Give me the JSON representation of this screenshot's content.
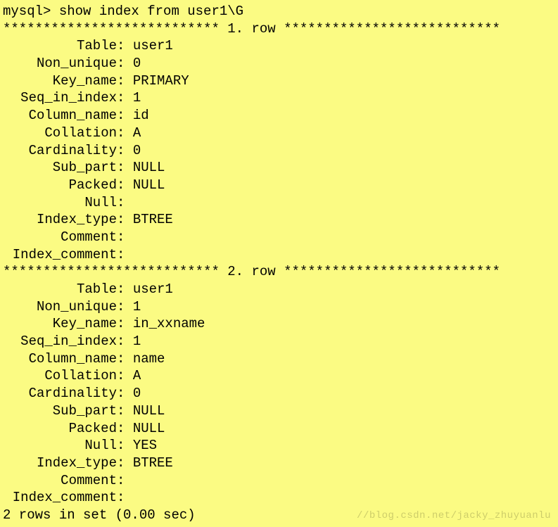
{
  "prompt": "mysql> show index from user1\\G",
  "row_separator_prefix": "*************************** ",
  "row_word": ". row ",
  "row_separator_suffix": "***************************",
  "rows": [
    {
      "index": "1",
      "fields": [
        {
          "label": "Table",
          "value": "user1"
        },
        {
          "label": "Non_unique",
          "value": "0"
        },
        {
          "label": "Key_name",
          "value": "PRIMARY"
        },
        {
          "label": "Seq_in_index",
          "value": "1"
        },
        {
          "label": "Column_name",
          "value": "id"
        },
        {
          "label": "Collation",
          "value": "A"
        },
        {
          "label": "Cardinality",
          "value": "0"
        },
        {
          "label": "Sub_part",
          "value": "NULL"
        },
        {
          "label": "Packed",
          "value": "NULL"
        },
        {
          "label": "Null",
          "value": ""
        },
        {
          "label": "Index_type",
          "value": "BTREE"
        },
        {
          "label": "Comment",
          "value": ""
        },
        {
          "label": "Index_comment",
          "value": ""
        }
      ]
    },
    {
      "index": "2",
      "fields": [
        {
          "label": "Table",
          "value": "user1"
        },
        {
          "label": "Non_unique",
          "value": "1"
        },
        {
          "label": "Key_name",
          "value": "in_xxname"
        },
        {
          "label": "Seq_in_index",
          "value": "1"
        },
        {
          "label": "Column_name",
          "value": "name"
        },
        {
          "label": "Collation",
          "value": "A"
        },
        {
          "label": "Cardinality",
          "value": "0"
        },
        {
          "label": "Sub_part",
          "value": "NULL"
        },
        {
          "label": "Packed",
          "value": "NULL"
        },
        {
          "label": "Null",
          "value": "YES"
        },
        {
          "label": "Index_type",
          "value": "BTREE"
        },
        {
          "label": "Comment",
          "value": ""
        },
        {
          "label": "Index_comment",
          "value": ""
        }
      ]
    }
  ],
  "footer": "2 rows in set (0.00 sec)",
  "watermark": "//blog.csdn.net/jacky_zhuyuanlu"
}
